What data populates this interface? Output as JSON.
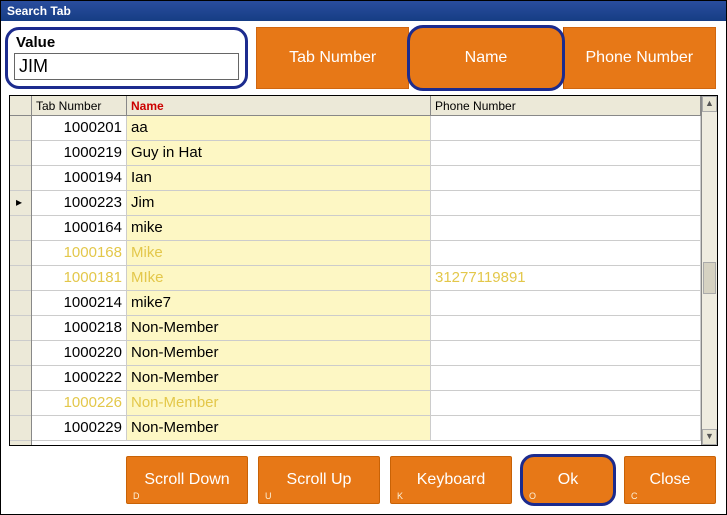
{
  "window": {
    "title": "Search Tab"
  },
  "search": {
    "label": "Value",
    "value": "JIM"
  },
  "filters": {
    "tab_number": "Tab Number",
    "name": "Name",
    "phone_number": "Phone Number",
    "selected": "name"
  },
  "columns": {
    "tab_number": "Tab Number",
    "name": "Name",
    "phone_number": "Phone Number",
    "sort": "name"
  },
  "rows": [
    {
      "tab": "1000201",
      "name": "aa",
      "phone": "",
      "dim": false,
      "current": false
    },
    {
      "tab": "1000219",
      "name": "Guy in Hat",
      "phone": "",
      "dim": false,
      "current": false
    },
    {
      "tab": "1000194",
      "name": "Ian",
      "phone": "",
      "dim": false,
      "current": false
    },
    {
      "tab": "1000223",
      "name": "Jim",
      "phone": "",
      "dim": false,
      "current": true
    },
    {
      "tab": "1000164",
      "name": "mike",
      "phone": "",
      "dim": false,
      "current": false
    },
    {
      "tab": "1000168",
      "name": "Mike",
      "phone": "",
      "dim": true,
      "current": false
    },
    {
      "tab": "1000181",
      "name": "MIke",
      "phone": "31277119891",
      "dim": true,
      "current": false
    },
    {
      "tab": "1000214",
      "name": "mike7",
      "phone": "",
      "dim": false,
      "current": false
    },
    {
      "tab": "1000218",
      "name": "Non-Member",
      "phone": "",
      "dim": false,
      "current": false
    },
    {
      "tab": "1000220",
      "name": "Non-Member",
      "phone": "",
      "dim": false,
      "current": false
    },
    {
      "tab": "1000222",
      "name": "Non-Member",
      "phone": "",
      "dim": false,
      "current": false
    },
    {
      "tab": "1000226",
      "name": "Non-Member",
      "phone": "",
      "dim": true,
      "current": false
    },
    {
      "tab": "1000229",
      "name": "Non-Member",
      "phone": "",
      "dim": false,
      "current": false
    }
  ],
  "footer": {
    "scroll_down": {
      "label": "Scroll Down",
      "hotkey": "D"
    },
    "scroll_up": {
      "label": "Scroll Up",
      "hotkey": "U"
    },
    "keyboard": {
      "label": "Keyboard",
      "hotkey": "K"
    },
    "ok": {
      "label": "Ok",
      "hotkey": "O"
    },
    "close": {
      "label": "Close",
      "hotkey": "C"
    }
  },
  "colors": {
    "accent": "#e77817",
    "focus_ring": "#1c2b8e",
    "name_col_bg": "#fdf7c4"
  }
}
